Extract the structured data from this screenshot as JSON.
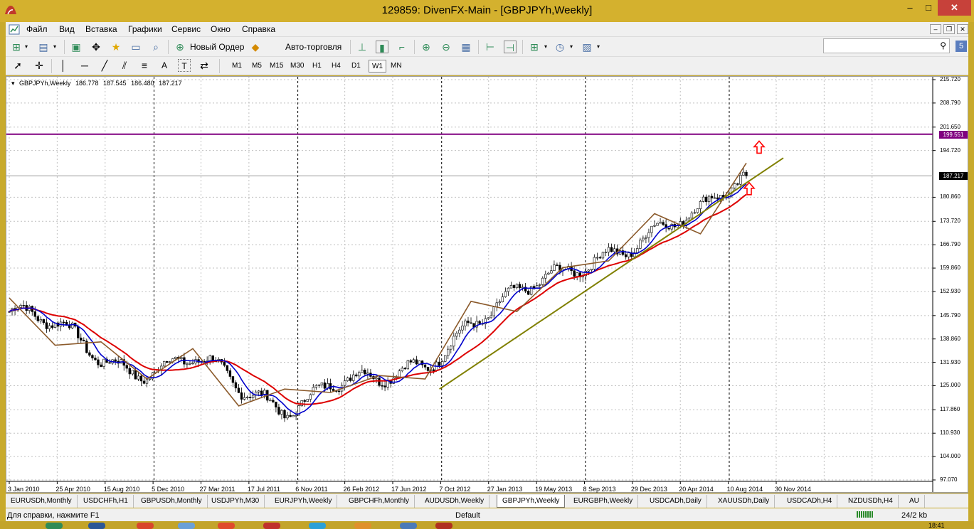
{
  "window": {
    "title": "129859: DivenFX-Main - [GBPJPYh,Weekly]",
    "minimize": "–",
    "maximize": "□",
    "close": "✕"
  },
  "menu": {
    "items": [
      "Файл",
      "Вид",
      "Вставка",
      "Графики",
      "Сервис",
      "Окно",
      "Справка"
    ]
  },
  "mdi_buttons": [
    "–",
    "❐",
    "✕"
  ],
  "toolbar": {
    "new_order_label": "Новый Ордер",
    "autotrade_label": "Авто-торговля",
    "search_placeholder": "",
    "notif_label": "5"
  },
  "toolbar2": {
    "tool_text_labels": [
      "A",
      "T"
    ],
    "timeframes": [
      "M1",
      "M5",
      "M15",
      "M30",
      "H1",
      "H4",
      "D1",
      "W1",
      "MN"
    ],
    "active_timeframe": "W1"
  },
  "chart_info": {
    "symbol": "GBPJPYh,Weekly",
    "open": "186.778",
    "high": "187.545",
    "low": "186.480",
    "close": "187.217"
  },
  "price_axis": {
    "labels": [
      "215.720",
      "208.790",
      "201.650",
      "194.720",
      "187.217",
      "180.860",
      "173.720",
      "166.790",
      "159.860",
      "152.930",
      "145.790",
      "138.860",
      "131.930",
      "125.000",
      "117.860",
      "110.930",
      "104.000",
      "97.070"
    ],
    "resistance_label": "199.551",
    "current_label": "187.217"
  },
  "date_axis": {
    "labels": [
      "3 Jan 2010",
      "25 Apr 2010",
      "15 Aug 2010",
      "5 Dec 2010",
      "27 Mar 2011",
      "17 Jul 2011",
      "6 Nov 2011",
      "26 Feb 2012",
      "17 Jun 2012",
      "7 Oct 2012",
      "27 Jan 2013",
      "19 May 2013",
      "8 Sep 2013",
      "29 Dec 2013",
      "20 Apr 2014",
      "10 Aug 2014",
      "30 Nov 2014"
    ]
  },
  "colors": {
    "resistance": "#800080",
    "ma_fast": "#0000cc",
    "ma_slow": "#dd0000",
    "zigzag": "#8b5a2b",
    "trendline": "#808000",
    "arrow": "#ff0000"
  },
  "chart_data": {
    "type": "line",
    "title": "GBPJPYh,Weekly",
    "ylim": [
      97.07,
      215.72
    ],
    "x": [
      "3 Jan 2010",
      "25 Apr 2010",
      "15 Aug 2010",
      "5 Dec 2010",
      "27 Mar 2011",
      "17 Jul 2011",
      "6 Nov 2011",
      "26 Feb 2012",
      "17 Jun 2012",
      "7 Oct 2012",
      "27 Jan 2013",
      "19 May 2013",
      "8 Sep 2013",
      "29 Dec 2013",
      "20 Apr 2014",
      "10 Aug 2014",
      "30 Nov 2014"
    ],
    "series": [
      {
        "values": [
          147,
          141,
          134,
          131,
          132,
          123,
          120,
          127,
          124,
          131,
          146,
          151,
          156,
          166,
          172,
          174,
          187
        ]
      }
    ],
    "horizontal_lines": [
      199.551,
      187.217
    ],
    "grid": true
  },
  "tabs": [
    "EURUSDh,Monthly",
    "USDCHFh,H1",
    "GBPUSDh,Monthly",
    "USDJPYh,M30",
    "EURJPYh,Weekly",
    "GBPCHFh,Monthly",
    "AUDUSDh,Weekly",
    "GBPJPYh,Weekly",
    "EURGBPh,Weekly",
    "USDCADh,Daily",
    "XAUUSDh,Daily",
    "USDCADh,H4",
    "NZDUSDh,H4",
    "AU"
  ],
  "active_tab": "GBPJPYh,Weekly",
  "status": {
    "help": "Для справки, нажмите F1",
    "profile": "Default",
    "traffic": "24/2 kb"
  },
  "taskbar": {
    "time": "18:41"
  }
}
